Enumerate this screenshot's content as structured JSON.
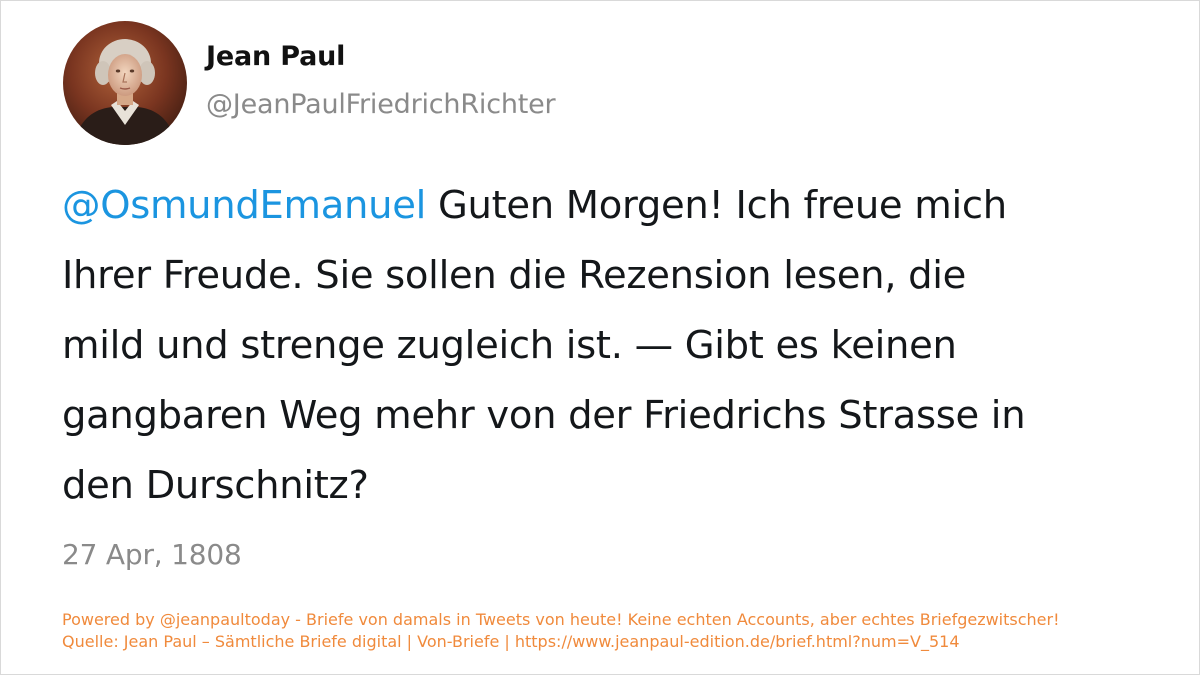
{
  "author": {
    "display_name": "Jean Paul",
    "handle": "@JeanPaulFriedrichRichter",
    "avatar": "portrait-avatar"
  },
  "tweet": {
    "mention": "@OsmundEmanuel",
    "line1_rest": " Guten Morgen! Ich freue mich",
    "line2": "Ihrer Freude. Sie sollen die Rezension lesen, die",
    "line3": "mild und strenge zugleich ist. — Gibt es keinen",
    "line4": "gangbaren Weg mehr von der Friedrichs Strasse in",
    "line5": "den Durschnitz?",
    "date": "27 Apr, 1808"
  },
  "footer": {
    "line1": "Powered by @jeanpaultoday - Briefe von damals in Tweets von heute! Keine echten Accounts, aber echtes Briefgezwitscher!",
    "line2": "Quelle: Jean Paul – Sämtliche Briefe digital | Von-Briefe | https://www.jeanpaul-edition.de/brief.html?num=V_514"
  },
  "colors": {
    "mention": "#1b95e0",
    "footer": "#f08a3c",
    "muted": "#8a8a8a",
    "text": "#14171a"
  }
}
